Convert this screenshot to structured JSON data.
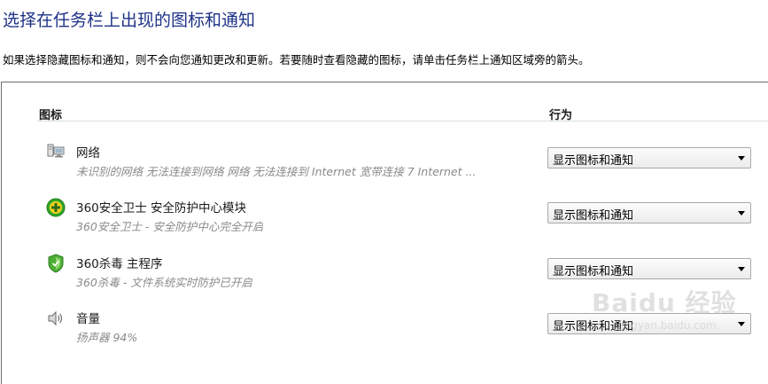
{
  "title": "选择在任务栏上出现的图标和通知",
  "description": "如果选择隐藏图标和通知，则不会向您通知更改和更新。若要随时查看隐藏的图标，请单击任务栏上通知区域旁的箭头。",
  "table": {
    "col_icon": "图标",
    "col_behavior": "行为"
  },
  "rows": [
    {
      "icon": "network-icon",
      "name": "网络",
      "detail": "未识别的网络 无法连接到网络 网络 无法连接到 Internet 宽带连接 7 Internet ...",
      "behavior": "显示图标和通知"
    },
    {
      "icon": "360-safe-guard-icon",
      "name": "360安全卫士 安全防护中心模块",
      "detail": "360安全卫士 - 安全防护中心完全开启",
      "behavior": "显示图标和通知"
    },
    {
      "icon": "360-antivirus-shield-icon",
      "name": "360杀毒 主程序",
      "detail": "360杀毒 - 文件系统实时防护已开启",
      "behavior": "显示图标和通知"
    },
    {
      "icon": "speaker-icon",
      "name": "音量",
      "detail": "扬声器 94%",
      "behavior": "显示图标和通知"
    }
  ],
  "watermark": {
    "line1": "Baidu 经验",
    "line2": "jingyan.baidu.com"
  },
  "colors": {
    "title": "#1e3287",
    "detail_text": "#8a8a8a",
    "guard_green": "#2fa82a",
    "shield_green": "#4caf35"
  }
}
